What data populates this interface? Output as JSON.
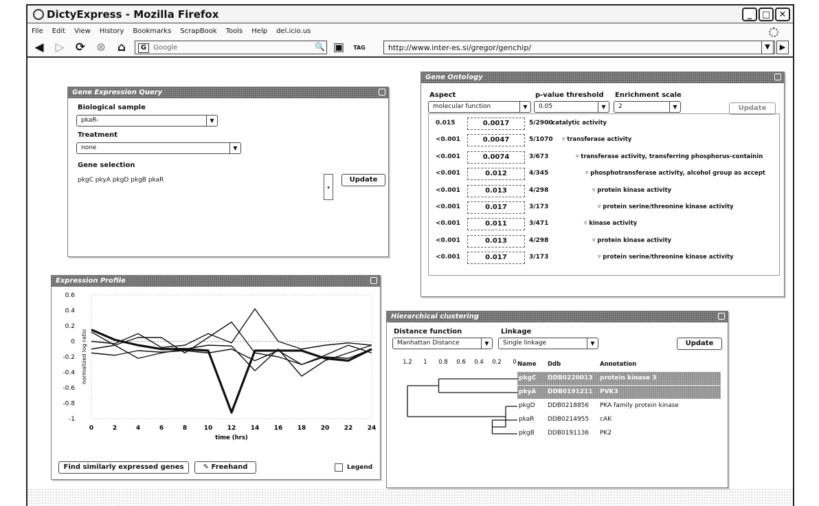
{
  "browser": {
    "title": "DictyExpress - Mozilla Firefox",
    "menu": [
      "File",
      "Edit",
      "View",
      "History",
      "Bookmarks",
      "ScrapBook",
      "Tools",
      "Help",
      "del.icio.us"
    ],
    "search_placeholder": "Google",
    "tag_label": "TAG",
    "url": "http://www.inter-es.si/gregor/genchip/"
  },
  "geq": {
    "title": "Gene Expression Query",
    "bio_label": "Biological sample",
    "bio_value": "pkaR-",
    "treatment_label": "Treatment",
    "treatment_value": "none",
    "gene_label": "Gene selection",
    "gene_value": "pkgC pkyA pkgD pkgB pkaR",
    "update": "Update"
  },
  "go": {
    "title": "Gene Ontology",
    "aspect_label": "Aspect",
    "aspect_value": "molecular function",
    "pval_label": "p-value threshold",
    "pval_value": "0.05",
    "scale_label": "Enrichment scale",
    "scale_value": "2",
    "update": "Update",
    "rows": [
      {
        "p": "0.015",
        "fdr": "0.0017",
        "count": "5/2900",
        "term": "catalytic activity"
      },
      {
        "p": "<0.001",
        "fdr": "0.0047",
        "count": "5/1070",
        "term": "transferase activity"
      },
      {
        "p": "<0.001",
        "fdr": "0.0074",
        "count": "3/673",
        "term": "transferase activity, transferring phosphorus-containin"
      },
      {
        "p": "<0.001",
        "fdr": "0.012",
        "count": "4/345",
        "term": "phosphotransferase activity, alcohol group as accept"
      },
      {
        "p": "<0.001",
        "fdr": "0.013",
        "count": "4/298",
        "term": "protein kinase activity"
      },
      {
        "p": "<0.001",
        "fdr": "0.017",
        "count": "3/173",
        "term": "protein serine/threonine kinase activity"
      },
      {
        "p": "<0.001",
        "fdr": "0.011",
        "count": "3/471",
        "term": "kinase activity"
      },
      {
        "p": "<0.001",
        "fdr": "0.013",
        "count": "4/298",
        "term": "protein kinase activity"
      },
      {
        "p": "<0.001",
        "fdr": "0.017",
        "count": "3/173",
        "term": "protein serine/threonine kinase activity"
      }
    ]
  },
  "profile": {
    "title": "Expression Profile",
    "find_button": "Find similarly expressed genes",
    "freehand_button": "Freehand",
    "legend_label": "Legend"
  },
  "hc": {
    "title": "Hierarchical clustering",
    "dist_label": "Distance function",
    "dist_value": "Manhattan Distance",
    "linkage_label": "Linkage",
    "linkage_value": "Single linkage",
    "update": "Update",
    "scale_ticks": [
      "1.2",
      "1",
      "0.8",
      "0.6",
      "0.4",
      "0.2",
      "0"
    ],
    "col_name": "Name",
    "col_ddb": "Ddb",
    "col_annotation": "Annotation",
    "rows": [
      {
        "name": "pkgC",
        "ddb": "DDB0220013",
        "annotation": "protein kinase 3",
        "selected": true
      },
      {
        "name": "pkyA",
        "ddb": "DDB0191211",
        "annotation": "PVK3",
        "selected": true
      },
      {
        "name": "pkgD",
        "ddb": "DDB0218856",
        "annotation": "PKA family protein kinase",
        "selected": false
      },
      {
        "name": "pkaR",
        "ddb": "DDB0214955",
        "annotation": "cAK",
        "selected": false
      },
      {
        "name": "pkgB",
        "ddb": "DDB0191136",
        "annotation": "PK2",
        "selected": false
      }
    ]
  },
  "chart_data": {
    "type": "line",
    "xlabel": "time (hrs)",
    "ylabel": "normalized log ratio",
    "xlim": [
      0,
      24
    ],
    "ylim": [
      -1,
      0.6
    ],
    "x": [
      0,
      2,
      4,
      6,
      8,
      10,
      12,
      14,
      16,
      18,
      20,
      22,
      24
    ],
    "xticks": [
      "0",
      "2",
      "4",
      "6",
      "8",
      "10",
      "12",
      "14",
      "16",
      "18",
      "20",
      "22",
      "24"
    ],
    "yticks": [
      "0.6",
      "0.4",
      "0.2",
      "0",
      "-0.2",
      "-0.4",
      "-0.6",
      "-0.8",
      "-1"
    ],
    "series": [
      {
        "values": [
          0.15,
          0.02,
          -0.05,
          -0.1,
          -0.1,
          -0.12,
          -0.92,
          -0.12,
          -0.12,
          -0.12,
          -0.22,
          -0.25,
          -0.1
        ],
        "bold": true
      },
      {
        "values": [
          0.0,
          -0.03,
          0.1,
          -0.08,
          -0.05,
          0.1,
          -0.02,
          0.42,
          0.0,
          -0.1,
          -0.05,
          -0.02,
          -0.05
        ],
        "bold": false
      },
      {
        "values": [
          0.12,
          -0.05,
          -0.22,
          -0.15,
          -0.1,
          -0.05,
          -0.06,
          -0.38,
          -0.1,
          -0.45,
          -0.25,
          -0.15,
          -0.05
        ],
        "bold": false
      },
      {
        "values": [
          -0.1,
          -0.05,
          0.05,
          0.05,
          -0.15,
          0.05,
          0.25,
          -0.15,
          -0.2,
          -0.3,
          -0.2,
          -0.22,
          -0.1
        ],
        "bold": false
      },
      {
        "values": [
          -0.15,
          -0.18,
          -0.12,
          -0.14,
          -0.12,
          -0.15,
          -0.1,
          -0.25,
          -0.12,
          -0.3,
          -0.18,
          -0.05,
          -0.15
        ],
        "bold": false
      }
    ]
  }
}
